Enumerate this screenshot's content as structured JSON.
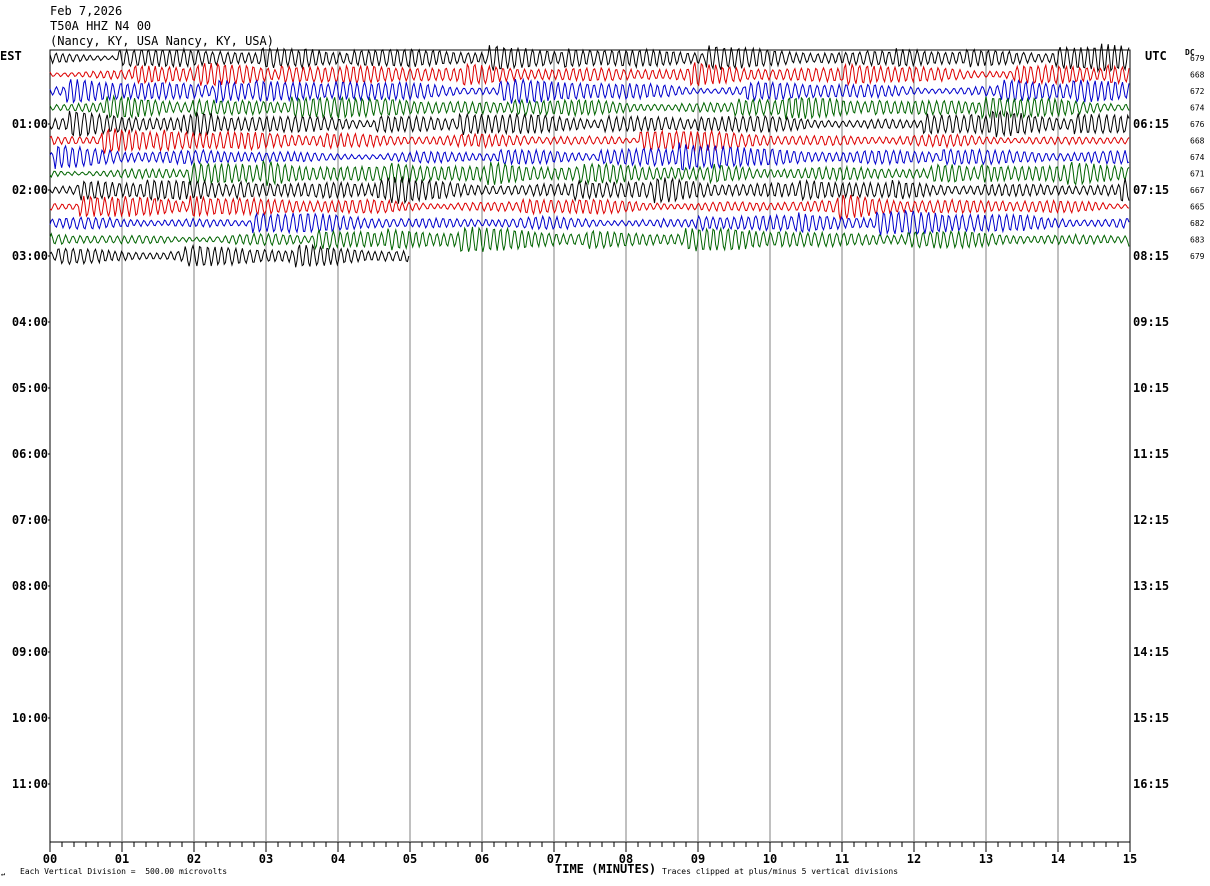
{
  "header": {
    "date": "Feb 7,2026",
    "station": "T50A HHZ N4 00",
    "location": "(Nancy, KY, USA Nancy, KY, USA)"
  },
  "corner_labels": {
    "left": "EST",
    "right": "UTC",
    "dc": "DC"
  },
  "footer": {
    "vertical_division": "Each Vertical Division =  500.00 microvolts",
    "clip_note": "Traces clipped at plus/minus 5 vertical divisions",
    "corner_mark": "↵"
  },
  "colors": {
    "black": "#000000",
    "red": "#dd0000",
    "blue": "#0000cc",
    "green": "#006400",
    "grid": "#808080"
  },
  "chart_data": {
    "type": "line",
    "title": "T50A HHZ N4 00",
    "xlabel": "TIME (MINUTES)",
    "ylabel": "",
    "xlim": [
      0,
      15
    ],
    "x_ticks": [
      "00",
      "01",
      "02",
      "03",
      "04",
      "05",
      "06",
      "07",
      "08",
      "09",
      "10",
      "11",
      "12",
      "13",
      "14",
      "15"
    ],
    "trace_minutes": 15,
    "traces_per_hour": 4,
    "est_hour_labels": [
      "01:00",
      "02:00",
      "03:00",
      "04:00",
      "05:00",
      "06:00",
      "07:00",
      "08:00",
      "09:00",
      "10:00",
      "11:00"
    ],
    "utc_hour_labels": [
      "06:15",
      "07:15",
      "08:15",
      "09:15",
      "10:15",
      "11:15",
      "12:15",
      "13:15",
      "14:15",
      "15:15",
      "16:15"
    ],
    "series": [
      {
        "dc": "679",
        "color": "black",
        "duration_min": 15
      },
      {
        "dc": "668",
        "color": "red",
        "duration_min": 15
      },
      {
        "dc": "672",
        "color": "blue",
        "duration_min": 15
      },
      {
        "dc": "674",
        "color": "green",
        "duration_min": 15
      },
      {
        "dc": "676",
        "color": "black",
        "duration_min": 15
      },
      {
        "dc": "668",
        "color": "red",
        "duration_min": 15
      },
      {
        "dc": "674",
        "color": "blue",
        "duration_min": 15
      },
      {
        "dc": "671",
        "color": "green",
        "duration_min": 15
      },
      {
        "dc": "667",
        "color": "black",
        "duration_min": 15
      },
      {
        "dc": "665",
        "color": "red",
        "duration_min": 15
      },
      {
        "dc": "682",
        "color": "blue",
        "duration_min": 15
      },
      {
        "dc": "683",
        "color": "green",
        "duration_min": 15
      },
      {
        "dc": "679",
        "color": "black",
        "duration_min": 5
      }
    ]
  }
}
